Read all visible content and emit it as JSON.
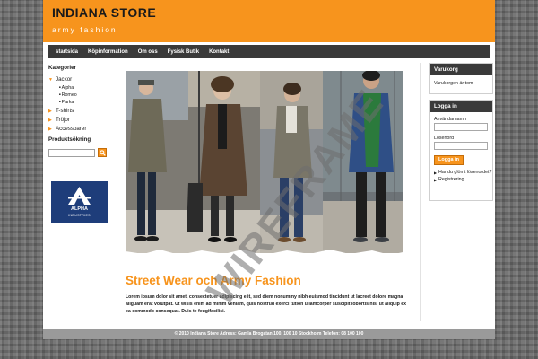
{
  "header": {
    "logo_line1": "INDIANA STORE",
    "logo_line2": "army fashion",
    "brand_color": "#f7941d"
  },
  "nav": {
    "items": [
      "startsida",
      "Köpinformation",
      "Om oss",
      "Fysisk Butik",
      "Kontakt"
    ]
  },
  "sidebar": {
    "categories_heading": "Kategorier",
    "categories": [
      {
        "label": "Jackor",
        "icon": "triangle-down-icon",
        "subitems": [
          "Alpha",
          "Romeo",
          "Parka"
        ]
      },
      {
        "label": "T-shirts",
        "icon": "triangle-right-icon"
      },
      {
        "label": "Tröjor",
        "icon": "triangle-right-icon"
      },
      {
        "label": "Accessoarer",
        "icon": "triangle-right-icon"
      }
    ],
    "search_heading": "Produktsökning",
    "search_placeholder": "",
    "search_icon": "search-icon",
    "brand_logo": {
      "line1": "ALPHA",
      "line2": "INDUSTRIES",
      "color": "#1e3d7a"
    }
  },
  "main": {
    "title": "Street Wear och Army Fashion",
    "body": "Lorem ipsum dolor sit amet, consectetuer adipiscing elit, sed diem nonummy nibh euismod tincidunt ut lacreet dolore magna aliguam erat volutpat. Ut wisis enim ad minim veniam, quis nostrud exerci tution ullamcorper suscipit lobortis nisl ut aliquip ex ea commodo consequat. Duis te feugifacilisi."
  },
  "cart": {
    "title": "Varukorg",
    "text": "Varukorgen är tom"
  },
  "login": {
    "title": "Logga in",
    "username_label": "Användarnamn",
    "password_label": "Lösenord",
    "button_label": "Logga in",
    "links": [
      "Har du glömt lösenordet?",
      "Registrering"
    ]
  },
  "footer": {
    "text": "© 2010 Indiana Store     Adress: Gamla Brogatan 100, 100 10 Stockholm     Telefon: 08 100 100"
  },
  "watermark": "WIREFRAME"
}
